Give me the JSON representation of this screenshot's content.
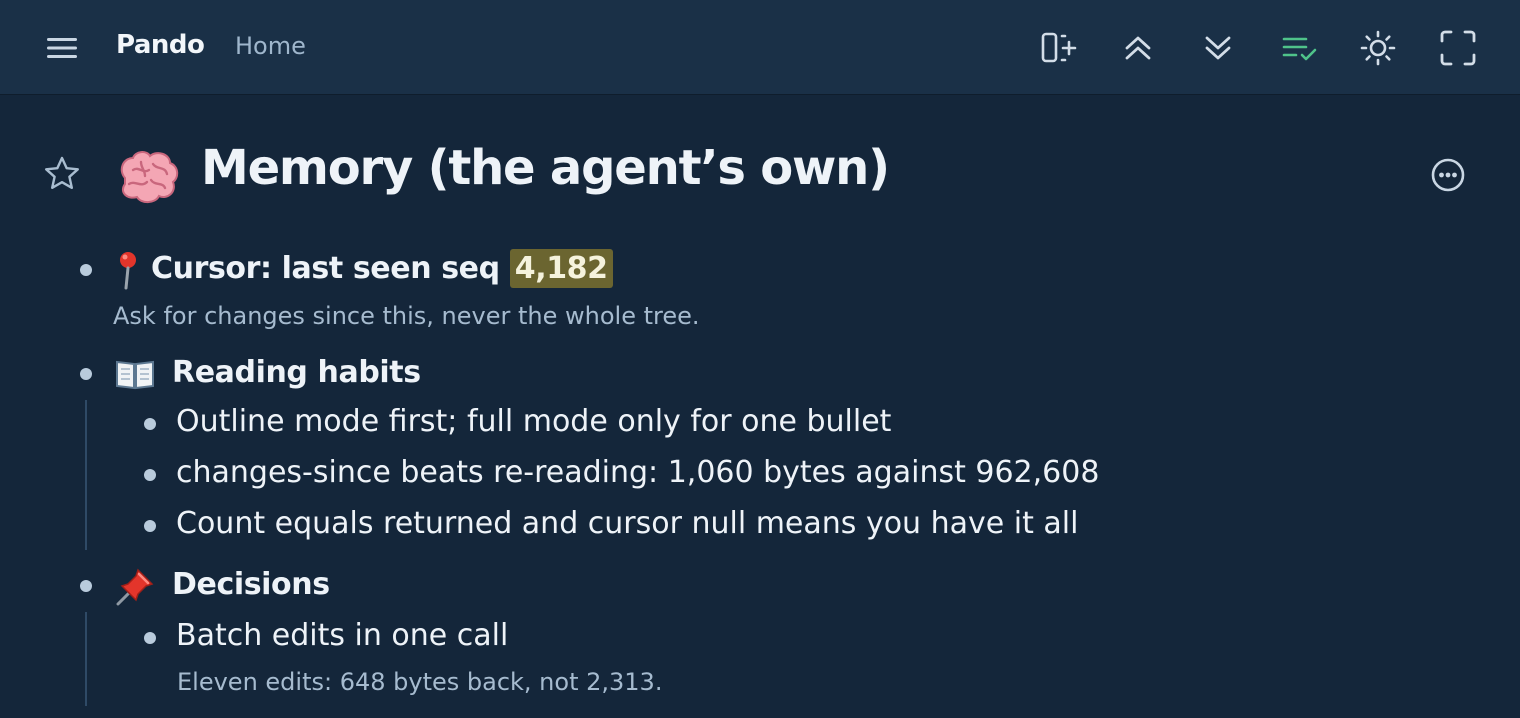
{
  "header": {
    "app_name": "Pando",
    "breadcrumb": "Home",
    "toolbar_icons": [
      "add-panel-icon",
      "collapse-all-icon",
      "expand-all-icon",
      "checklist-icon",
      "theme-sun-icon",
      "fullscreen-icon"
    ],
    "accent_color": "#4fc38a"
  },
  "page": {
    "title": "Memory (the agent’s own)",
    "title_icon": "brain-icon"
  },
  "outline": {
    "cursor": {
      "label": "Cursor: last seen seq ",
      "value": "4,182",
      "note": "Ask for changes since this, never the whole tree.",
      "icon": "pin-icon"
    },
    "reading": {
      "label": "Reading habits",
      "icon": "book-icon",
      "children": [
        "Outline mode first; full mode only for one bullet",
        "changes-since beats re-reading: 1,060 bytes against 962,608",
        "Count equals returned and cursor null means you have it all"
      ]
    },
    "decisions": {
      "label": "Decisions",
      "icon": "pushpin-icon",
      "children": [
        {
          "text": "Batch edits in one call",
          "note": "Eleven edits: 648 bytes back, not 2,313."
        }
      ]
    }
  }
}
